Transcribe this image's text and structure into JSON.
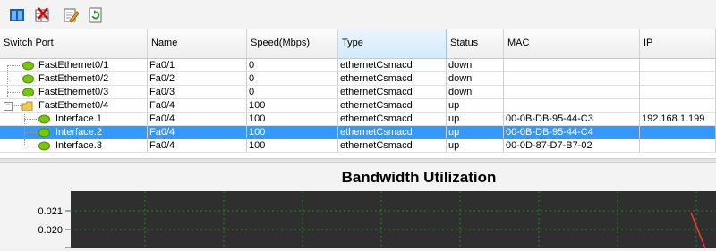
{
  "toolbar": {
    "buttons": [
      {
        "name": "columns-icon"
      },
      {
        "name": "table-delete-icon"
      },
      {
        "name": "edit-pencil-icon"
      },
      {
        "name": "refresh-icon"
      }
    ]
  },
  "table": {
    "columns": [
      "Switch Port",
      "Name",
      "Speed(Mbps)",
      "Type",
      "Status",
      "MAC",
      "IP"
    ],
    "rows": [
      {
        "port": "FastEthernet0/1",
        "name": "Fa0/1",
        "speed": "0",
        "type": "ethernetCsmacd",
        "status": "down",
        "mac": "",
        "ip": ""
      },
      {
        "port": "FastEthernet0/2",
        "name": "Fa0/2",
        "speed": "0",
        "type": "ethernetCsmacd",
        "status": "down",
        "mac": "",
        "ip": ""
      },
      {
        "port": "FastEthernet0/3",
        "name": "Fa0/3",
        "speed": "0",
        "type": "ethernetCsmacd",
        "status": "down",
        "mac": "",
        "ip": ""
      },
      {
        "port": "FastEthernet0/4",
        "name": "Fa0/4",
        "speed": "100",
        "type": "ethernetCsmacd",
        "status": "up",
        "mac": "",
        "ip": "",
        "expanded": true,
        "expander": "−"
      },
      {
        "port": "Interface.1",
        "name": "Fa0/4",
        "speed": "100",
        "type": "ethernetCsmacd",
        "status": "up",
        "mac": "00-0B-DB-95-44-C3",
        "ip": "192.168.1.199"
      },
      {
        "port": "Interface.2",
        "name": "Fa0/4",
        "speed": "100",
        "type": "ethernetCsmacd",
        "status": "up",
        "mac": "00-0B-DB-95-44-C4",
        "ip": "",
        "selected": true
      },
      {
        "port": "Interface.3",
        "name": "Fa0/4",
        "speed": "100",
        "type": "ethernetCsmacd",
        "status": "up",
        "mac": "00-0D-87-D7-B7-02",
        "ip": ""
      }
    ]
  },
  "chart": {
    "title": "Bandwidth Utilization",
    "y_ticks": [
      "0.021",
      "0.020"
    ],
    "plot_bg": "#2f2f2f",
    "grid_color": "#1e8a1e",
    "line_color": "#ff3333"
  },
  "colors": {
    "selection": "#3399ff",
    "node_green": "#78c800",
    "folder_yellow": "#f2c94c"
  }
}
